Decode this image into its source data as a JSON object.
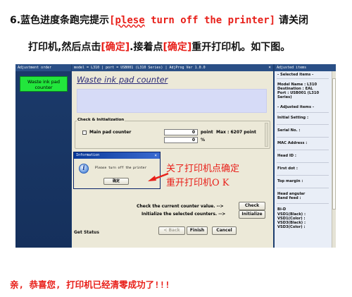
{
  "instruction": {
    "line1_prefix": "6.蓝色进度条跑完提示",
    "line1_bracket_open": "[",
    "line1_msg_a": "plese",
    "line1_msg_b": " turn off the printer",
    "line1_bracket_close": "]",
    "line1_suffix": " 请关闭",
    "line2_a": "打印机,然后点击",
    "line2_confirm1": "[确定]",
    "line2_b": ".接着点",
    "line2_confirm2": "[确定]",
    "line2_c": "重开打印机。如下图。"
  },
  "window": {
    "left_title": "Adjustment order",
    "mid_title": "model = L310 | port = USB001 (L310 Series) | AdjProg Ver 1.0.0",
    "close_glyph": "×",
    "right_title": "Adjusted items"
  },
  "left_col": {
    "active_item": "Waste ink pad counter"
  },
  "main": {
    "title": "Waste ink pad counter",
    "check_group_title": "Check & Initialization",
    "main_pad_label": "Main pad counter",
    "point_value": "0",
    "point_unit": "point",
    "max_label": "Max : 6207 point",
    "percent_value": "0",
    "percent_unit": "%",
    "check_prompt": "Check the current counter value. -->",
    "check_button": "Check",
    "init_prompt": "Initialize the selected counters. -->",
    "initialize_button": "Initialize",
    "get_status": "Get Status",
    "back_button": "< Back",
    "finish_button": "Finish",
    "cancel_button": "Cancel"
  },
  "dialog": {
    "title": "Information",
    "close_glyph": "×",
    "message": "Please turn off the printer",
    "ok_button": "确定",
    "icon": "info-icon"
  },
  "annotation": {
    "line1": "关了打印机点确定",
    "line2": "重开打印机O K"
  },
  "right_col": {
    "selected_header": "- Selected items -",
    "model_name": "Model Name : L310",
    "destination": "Destination : EAL",
    "port": "Port : USB001 (L310",
    "series": "Series)",
    "adjusted_header": "- Adjusted items -",
    "initial_setting": "Initial Setting :",
    "serial_no": "Serial No. :",
    "mac_address": "MAC Address :",
    "head_id": "Head ID :",
    "first_dot": "First dot :",
    "top_margin": "Top margin :",
    "head_angular": "Head angular",
    "band_feed": "Band feed :",
    "bid": "Bi-D",
    "vsd1": "VSD1(Black) :",
    "vsd1c": "VSD1(Color) :",
    "vsd3": "VSD3(Black) :",
    "vsd3c": "VSD3(Color) :"
  },
  "footer": {
    "text": "亲, 恭喜您, 打印机已经清零成功了!!!"
  },
  "colors": {
    "accent_red": "#e8201a",
    "active_green": "#22e63c",
    "title_blue": "#2a2a78"
  }
}
